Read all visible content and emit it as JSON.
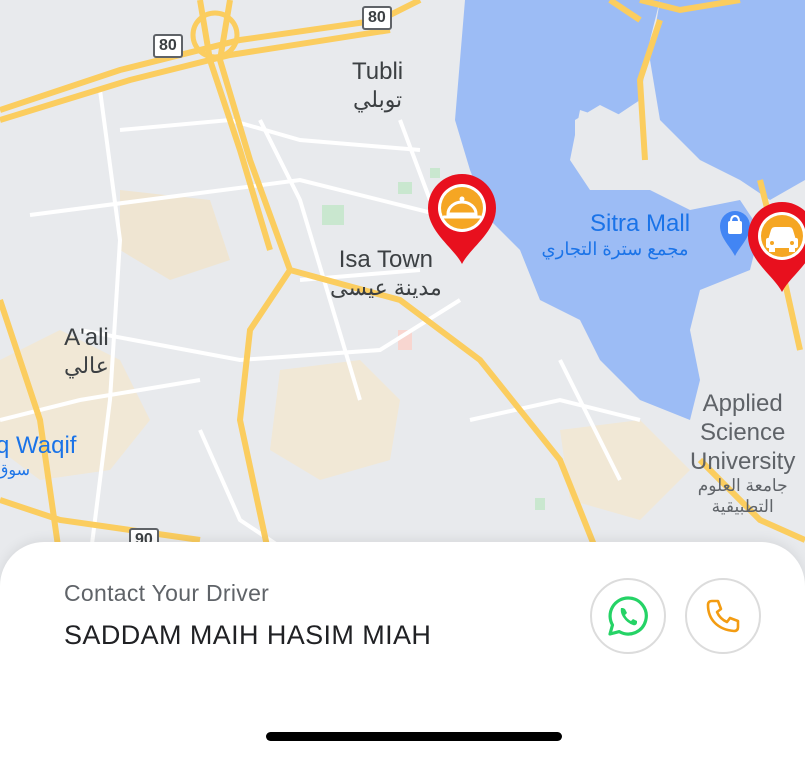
{
  "map": {
    "places": [
      {
        "id": "tubli",
        "name": "Tubli",
        "name_ar": "توبلي"
      },
      {
        "id": "isa-town",
        "name": "Isa Town",
        "name_ar": "مدينة عيسى"
      },
      {
        "id": "aali",
        "name": "A'ali",
        "name_ar": "عالي"
      },
      {
        "id": "souq-waqif",
        "name": "q Waqif",
        "name_ar": "سوق"
      },
      {
        "id": "sitra-mall",
        "name": "Sitra Mall",
        "name_ar": "مجمع سترة التجاري"
      },
      {
        "id": "applied-science",
        "name": "Applied Science University",
        "line1": "Applied",
        "line2": "Science",
        "line3": "University",
        "ar1": "جامعة العلوم",
        "ar2": "التطبيقية"
      }
    ],
    "road_shields": [
      "80",
      "80",
      "90"
    ],
    "markers": [
      {
        "id": "restaurant",
        "icon": "food-cloche-icon",
        "color": "#e8101e",
        "inner": "#f5a623"
      },
      {
        "id": "car",
        "icon": "car-icon",
        "color": "#e8101e",
        "inner": "#f5a623"
      }
    ],
    "colors": {
      "water": "#9cbcf5",
      "land": "#e8eaed",
      "road": "#fbcd5f",
      "urban": "#f3ead9"
    }
  },
  "contact": {
    "title": "Contact Your Driver",
    "driver_name": "SADDAM MAIH HASIM MIAH",
    "whatsapp_icon": "whatsapp-icon",
    "phone_icon": "phone-icon",
    "accent": "#f39c12",
    "whatsapp_color": "#25d366"
  }
}
